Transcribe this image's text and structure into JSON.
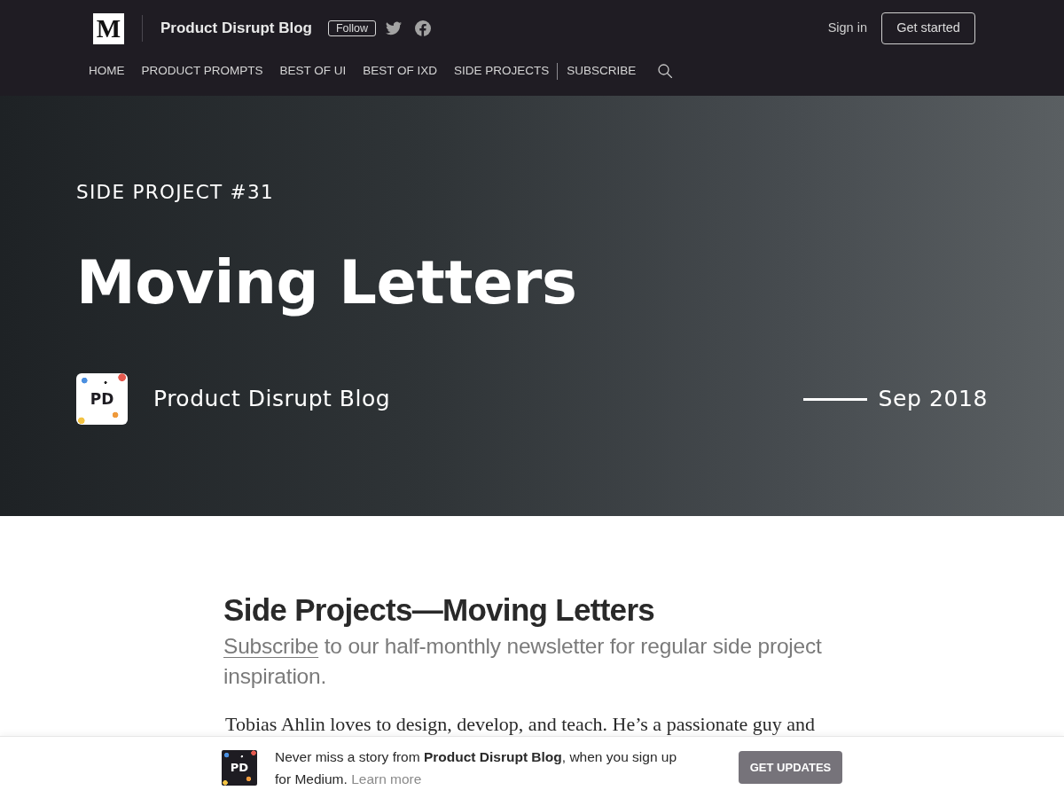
{
  "header": {
    "logo_letter": "M",
    "publication": "Product Disrupt Blog",
    "follow_button": "Follow",
    "sign_in": "Sign in",
    "get_started": "Get started"
  },
  "nav_groups": [
    {
      "items": [
        "HOME",
        "PRODUCT PROMPTS",
        "BEST OF UI",
        "BEST OF IXD",
        "SIDE PROJECTS"
      ]
    },
    {
      "items": [
        "SUBSCRIBE"
      ]
    }
  ],
  "hero": {
    "kicker": "SIDE PROJECT #31",
    "title": "Moving Letters",
    "logo_text": "PD",
    "author": "Product Disrupt Blog",
    "date": "Sep 2018"
  },
  "article": {
    "title": "Side Projects—Moving Letters",
    "subtitle_link": "Subscribe",
    "subtitle": "to our half-monthly newsletter for regular side project inspiration.",
    "paragraph": "Tobias Ahlin loves to design, develop, and teach. He’s a passionate guy and"
  },
  "banner": {
    "logo_text": "PD",
    "message": "Never miss a story from **Product Disrupt Blog**, when you sign up for Medium.",
    "link": "Learn more",
    "button": "GET UPDATES"
  }
}
